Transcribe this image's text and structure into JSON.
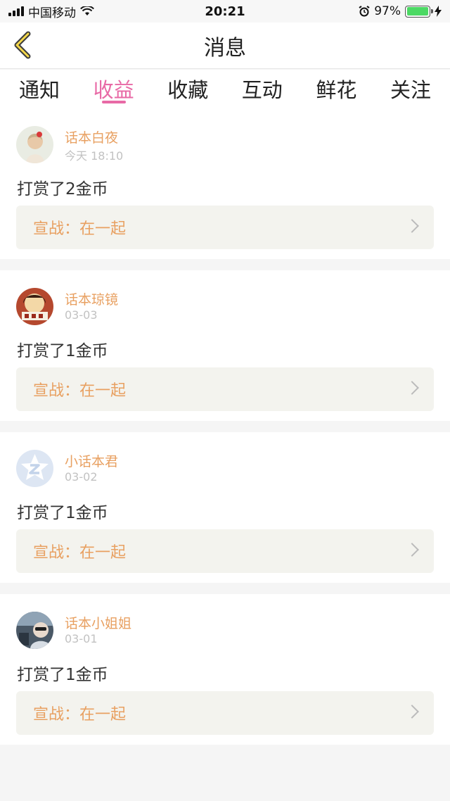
{
  "status_bar": {
    "carrier": "中国移动",
    "time": "20:21",
    "battery_pct": "97%",
    "battery_level": 0.97
  },
  "nav": {
    "title": "消息"
  },
  "tabs": [
    {
      "label": "通知",
      "active": false
    },
    {
      "label": "收益",
      "active": true
    },
    {
      "label": "收藏",
      "active": false
    },
    {
      "label": "互动",
      "active": false
    },
    {
      "label": "鲜花",
      "active": false
    },
    {
      "label": "关注",
      "active": false
    }
  ],
  "messages": [
    {
      "username": "话本白夜",
      "time": "今天 18:10",
      "content": "打赏了2金币",
      "challenge": "宣战：在一起",
      "avatar": "avatar-photo-girl"
    },
    {
      "username": "话本琼镜",
      "time": "03-03",
      "content": "打赏了1金币",
      "challenge": "宣战：在一起",
      "avatar": "avatar-cartoon"
    },
    {
      "username": "小话本君",
      "time": "03-02",
      "content": "打赏了1金币",
      "challenge": "宣战：在一起",
      "avatar": "avatar-default-z"
    },
    {
      "username": "话本小姐姐",
      "time": "03-01",
      "content": "打赏了1金币",
      "challenge": "宣战：在一起",
      "avatar": "avatar-photo-car"
    }
  ],
  "colors": {
    "accent_pink": "#e86aa6",
    "accent_orange": "#e8a061",
    "card_bg": "#f3f3ee"
  }
}
